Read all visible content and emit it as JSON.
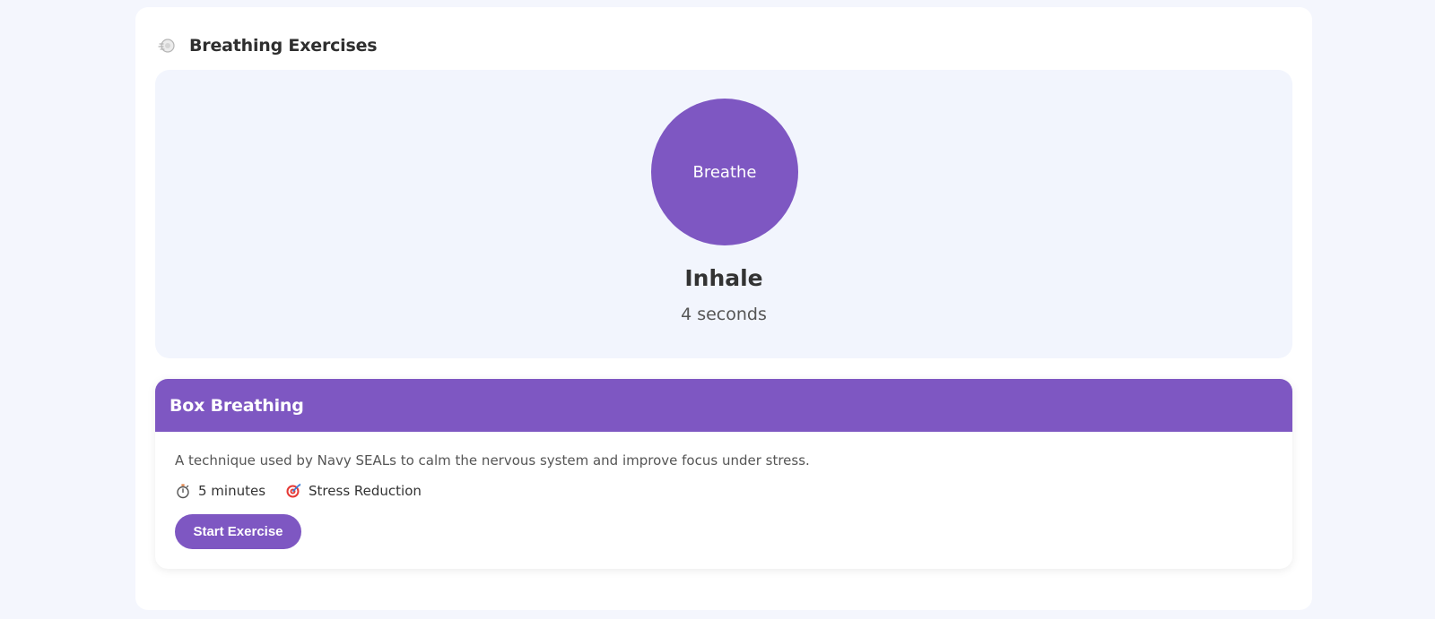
{
  "header": {
    "icon": "meditation-icon",
    "title": "Breathing Exercises"
  },
  "breath": {
    "circle_label": "Breathe",
    "phase": "Inhale",
    "duration": "4 seconds"
  },
  "exercise": {
    "title": "Box Breathing",
    "description": "A technique used by Navy SEALs to calm the nervous system and improve focus under stress.",
    "meta": [
      {
        "icon": "stopwatch-icon",
        "label": "5 minutes"
      },
      {
        "icon": "target-icon",
        "label": "Stress Reduction"
      }
    ],
    "start_label": "Start Exercise"
  },
  "colors": {
    "accent": "#7e57c2",
    "background": "#f4f6fd",
    "panel": "#f2f5fd"
  }
}
